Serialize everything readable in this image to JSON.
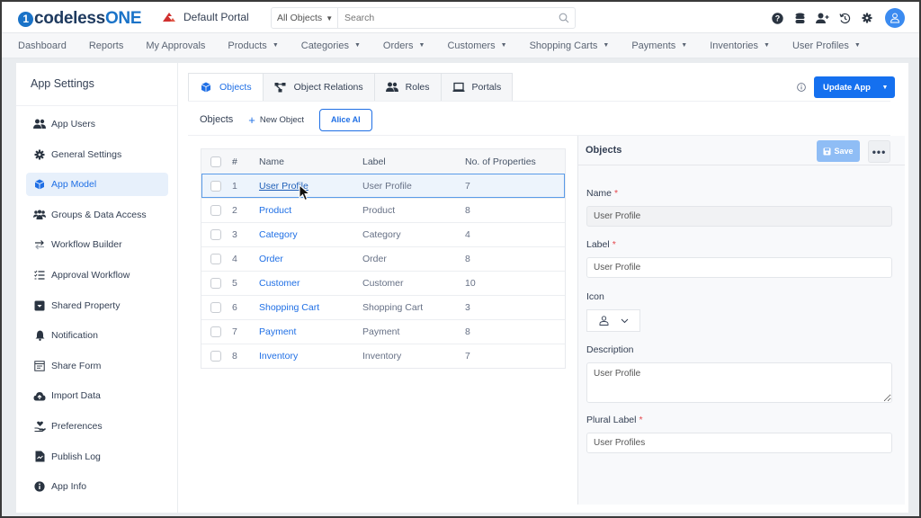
{
  "app": {
    "logo_prefix": "1",
    "logo_main": "codeless",
    "logo_suffix": "ONE",
    "portal_name": "Default Portal"
  },
  "search": {
    "scope": "All Objects",
    "placeholder": "Search"
  },
  "top_icons": [
    "help-icon",
    "database-icon",
    "add-user-icon",
    "history-icon",
    "gear-icon",
    "user-avatar"
  ],
  "nav": {
    "items": [
      {
        "label": "Dashboard",
        "dropdown": false
      },
      {
        "label": "Reports",
        "dropdown": false
      },
      {
        "label": "My Approvals",
        "dropdown": false
      },
      {
        "label": "Products",
        "dropdown": true
      },
      {
        "label": "Categories",
        "dropdown": true
      },
      {
        "label": "Orders",
        "dropdown": true
      },
      {
        "label": "Customers",
        "dropdown": true
      },
      {
        "label": "Shopping Carts",
        "dropdown": true
      },
      {
        "label": "Payments",
        "dropdown": true
      },
      {
        "label": "Inventories",
        "dropdown": true
      },
      {
        "label": "User Profiles",
        "dropdown": true
      }
    ]
  },
  "sidebar": {
    "title": "App Settings",
    "items": [
      {
        "label": "App Users",
        "icon": "users-icon"
      },
      {
        "label": "General Settings",
        "icon": "gear-icon"
      },
      {
        "label": "App Model",
        "icon": "cube-icon",
        "active": true
      },
      {
        "label": "Groups & Data Access",
        "icon": "groups-icon"
      },
      {
        "label": "Workflow Builder",
        "icon": "exchange-icon"
      },
      {
        "label": "Approval Workflow",
        "icon": "checklist-icon"
      },
      {
        "label": "Shared Property",
        "icon": "inbox-icon"
      },
      {
        "label": "Notification",
        "icon": "bell-icon"
      },
      {
        "label": "Share Form",
        "icon": "form-icon"
      },
      {
        "label": "Import Data",
        "icon": "cloud-upload-icon"
      },
      {
        "label": "Preferences",
        "icon": "hand-heart-icon"
      },
      {
        "label": "Publish Log",
        "icon": "file-log-icon"
      },
      {
        "label": "App Info",
        "icon": "info-circle-icon"
      }
    ]
  },
  "tabs": [
    {
      "label": "Objects",
      "icon": "cube-icon",
      "active": true
    },
    {
      "label": "Object Relations",
      "icon": "relations-icon"
    },
    {
      "label": "Roles",
      "icon": "users-icon"
    },
    {
      "label": "Portals",
      "icon": "laptop-icon"
    }
  ],
  "toolbar": {
    "update_app": "Update App",
    "objects_label": "Objects",
    "new_object": "New Object",
    "alice_ai": "Alice AI"
  },
  "table": {
    "headers": [
      "#",
      "Name",
      "Label",
      "No. of Properties"
    ],
    "rows": [
      {
        "num": "1",
        "name": "User Profile",
        "label": "User Profile",
        "props": "7",
        "selected": true
      },
      {
        "num": "2",
        "name": "Product",
        "label": "Product",
        "props": "8"
      },
      {
        "num": "3",
        "name": "Category",
        "label": "Category",
        "props": "4"
      },
      {
        "num": "4",
        "name": "Order",
        "label": "Order",
        "props": "8"
      },
      {
        "num": "5",
        "name": "Customer",
        "label": "Customer",
        "props": "10"
      },
      {
        "num": "6",
        "name": "Shopping Cart",
        "label": "Shopping Cart",
        "props": "3"
      },
      {
        "num": "7",
        "name": "Payment",
        "label": "Payment",
        "props": "8"
      },
      {
        "num": "8",
        "name": "Inventory",
        "label": "Inventory",
        "props": "7"
      }
    ]
  },
  "panel": {
    "title": "Objects",
    "save_label": "Save",
    "more_label": "•••",
    "fields": {
      "name_label": "Name",
      "name_value": "User Profile",
      "label_label": "Label",
      "label_value": "User Profile",
      "icon_label": "Icon",
      "icon_value": "user-icon",
      "description_label": "Description",
      "description_value": "User Profile",
      "plural_label": "Plural Label",
      "plural_value": "User Profiles",
      "required_mark": "*"
    }
  },
  "colors": {
    "accent": "#1570ef",
    "link": "#1f6fe5",
    "required": "#e5484d",
    "save_disabled": "#8fbdf5"
  }
}
